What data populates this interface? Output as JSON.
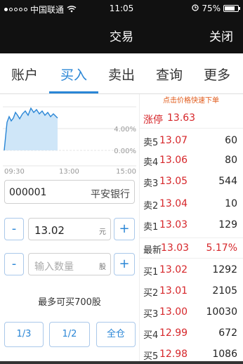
{
  "status": {
    "carrier": "中国联通",
    "time": "11:05",
    "battery": "75%",
    "battery_level": 0.75
  },
  "nav": {
    "title": "交易",
    "close": "关闭"
  },
  "tabs": [
    {
      "label": "账户"
    },
    {
      "label": "买入"
    },
    {
      "label": "卖出"
    },
    {
      "label": "查询"
    },
    {
      "label": "更多"
    }
  ],
  "chart": {
    "pct_labels": [
      "4.00%",
      "0.00%"
    ],
    "time_labels": [
      "09:30",
      "13:00",
      "15:00"
    ]
  },
  "stock": {
    "code": "000001",
    "name": "平安银行"
  },
  "price": {
    "value": "13.02",
    "unit": "元",
    "minus": "-",
    "plus": "+"
  },
  "qty": {
    "placeholder": "输入数量",
    "unit": "股",
    "minus": "-",
    "plus": "+"
  },
  "max_buy": "最多可买700股",
  "ratio_buttons": [
    "1/3",
    "1/2",
    "全仓"
  ],
  "orderbook": {
    "hint": "点击价格快速下单",
    "limit_label": "涨停",
    "limit_value": "13.63",
    "sells": [
      {
        "label": "卖5",
        "price": "13.07",
        "vol": "60"
      },
      {
        "label": "卖4",
        "price": "13.06",
        "vol": "80"
      },
      {
        "label": "卖3",
        "price": "13.05",
        "vol": "544"
      },
      {
        "label": "卖2",
        "price": "13.04",
        "vol": "10"
      },
      {
        "label": "卖1",
        "price": "13.03",
        "vol": "129"
      }
    ],
    "latest": {
      "label": "最新",
      "price": "13.03",
      "pct": "5.17%"
    },
    "buys": [
      {
        "label": "买1",
        "price": "13.02",
        "vol": "1292"
      },
      {
        "label": "买2",
        "price": "13.01",
        "vol": "2105"
      },
      {
        "label": "买3",
        "price": "13.00",
        "vol": "10030"
      },
      {
        "label": "买4",
        "price": "12.99",
        "vol": "672"
      },
      {
        "label": "买5",
        "price": "12.98",
        "vol": "1086"
      }
    ]
  },
  "colors": {
    "accent": "#2a86d6",
    "rise": "#d6262a",
    "hint": "#e05a1a"
  }
}
